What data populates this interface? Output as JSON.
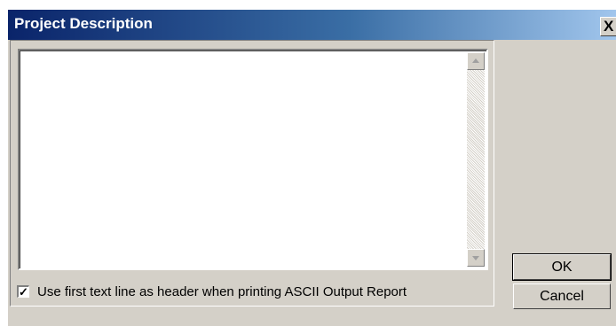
{
  "dialog": {
    "title": "Project Description",
    "close_glyph": "X",
    "description_text": "",
    "checkbox": {
      "label": "Use first text line as header when printing ASCII Output Report",
      "checked": true,
      "glyph": "✓"
    },
    "ok_label": "OK",
    "cancel_label": "Cancel"
  }
}
